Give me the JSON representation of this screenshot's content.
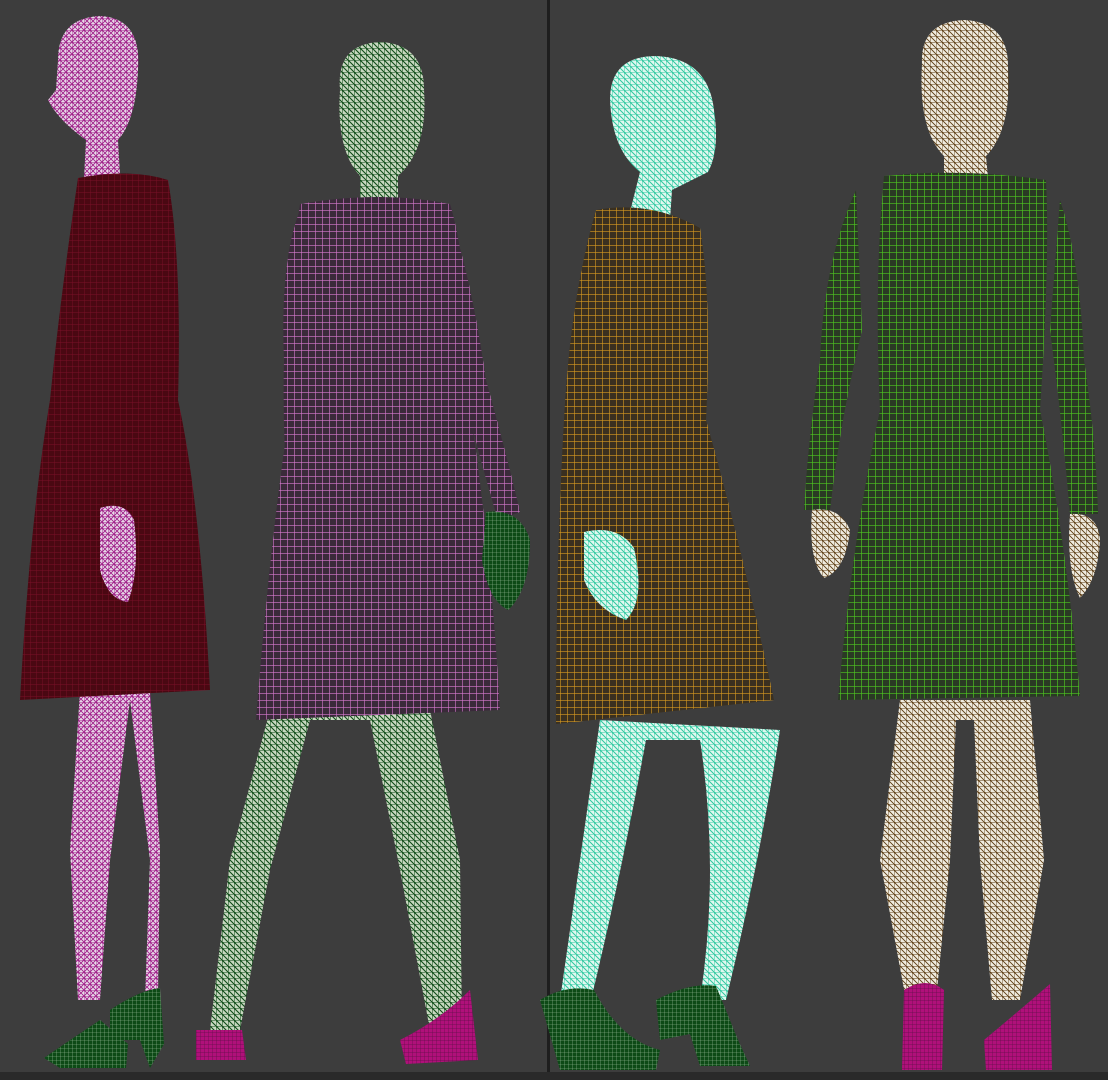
{
  "app": {
    "viewports": [
      {
        "id": "left",
        "models": [
          "side-view",
          "front-walking"
        ]
      },
      {
        "id": "right",
        "models": [
          "side-walking",
          "back-view"
        ]
      }
    ]
  },
  "colors": {
    "background": "#3d3d3d",
    "divider": "#1e1e1e",
    "model_1_body": "#b02a9a",
    "model_1_dress": "#5a0a14",
    "model_2_body": "#0d4a16",
    "model_2_dress": "#d87ad0",
    "model_3_body": "#3ed6b0",
    "model_3_dress": "#d89a20",
    "model_4_body": "#d8d0c0",
    "model_4_dress": "#4ec820",
    "shoe_magenta": "#b0107a",
    "shoe_green": "#0d4a16"
  }
}
